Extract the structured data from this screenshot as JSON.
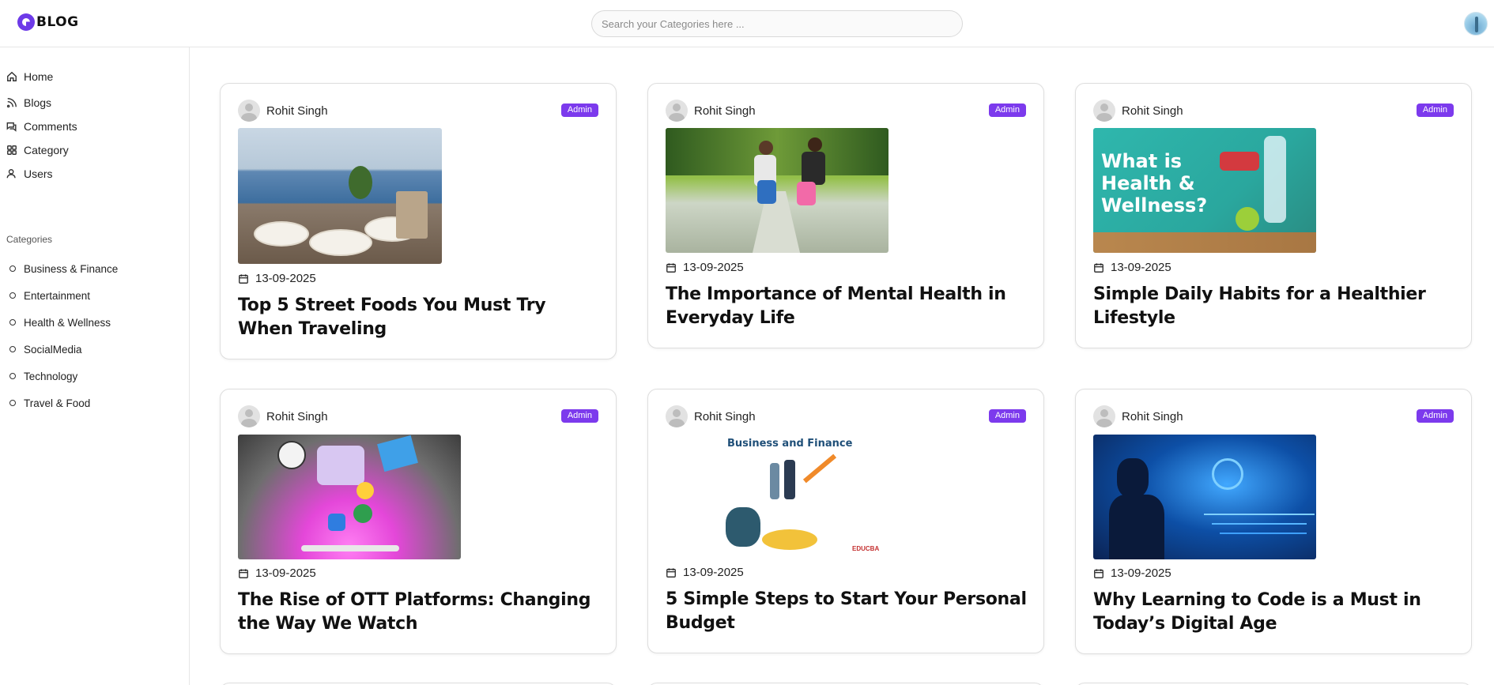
{
  "header": {
    "logo_text": "BLOG",
    "search_placeholder": "Search your Categories here ..."
  },
  "sidebar": {
    "nav": [
      {
        "label": "Home",
        "icon": "home-icon"
      },
      {
        "label": "Blogs",
        "icon": "rss-icon"
      },
      {
        "label": "Comments",
        "icon": "comments-icon"
      },
      {
        "label": "Category",
        "icon": "grid-icon"
      },
      {
        "label": "Users",
        "icon": "users-icon"
      }
    ],
    "categories_heading": "Categories",
    "categories": [
      "Business & Finance",
      "Entertainment",
      "Health & Wellness",
      "SocialMedia",
      "Technology",
      "Travel & Food"
    ]
  },
  "cards": [
    {
      "author": "Rohit Singh",
      "badge": "Admin",
      "date": "13-09-2025",
      "title": "Top 5 Street Foods You Must Try When Traveling"
    },
    {
      "author": "Rohit Singh",
      "badge": "Admin",
      "date": "13-09-2025",
      "title": "The Importance of Mental Health in Everyday Life"
    },
    {
      "author": "Rohit Singh",
      "badge": "Admin",
      "date": "13-09-2025",
      "title": "Simple Daily Habits for a Healthier Lifestyle",
      "image_text": "What is Health & Wellness?"
    },
    {
      "author": "Rohit Singh",
      "badge": "Admin",
      "date": "13-09-2025",
      "title": "The Rise of OTT Platforms: Changing the Way We Watch"
    },
    {
      "author": "Rohit Singh",
      "badge": "Admin",
      "date": "13-09-2025",
      "title": "5 Simple Steps to Start Your Personal Budget",
      "image_text": "Business and Finance",
      "image_brand": "EDUCBA"
    },
    {
      "author": "Rohit Singh",
      "badge": "Admin",
      "date": "13-09-2025",
      "title": "Why Learning to Code is a Must in Today’s Digital Age"
    }
  ],
  "colors": {
    "accent": "#7c3aed",
    "border": "#dedede"
  }
}
